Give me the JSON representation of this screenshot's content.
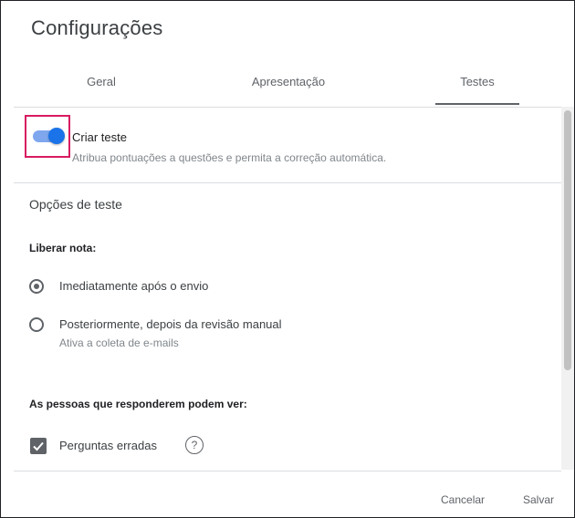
{
  "dialog": {
    "title": "Configurações"
  },
  "tabs": [
    {
      "label": "Geral",
      "active": false
    },
    {
      "label": "Apresentação",
      "active": false
    },
    {
      "label": "Testes",
      "active": true
    }
  ],
  "quiz": {
    "toggle_on": true,
    "title": "Criar teste",
    "description": "Atribua pontuações a questões e permita a correção automática."
  },
  "options": {
    "section_title": "Opções de teste",
    "release_label": "Liberar nota:",
    "release_options": [
      {
        "label": "Imediatamente após o envio",
        "checked": true,
        "sub": ""
      },
      {
        "label": "Posteriormente, depois da revisão manual",
        "checked": false,
        "sub": "Ativa a coleta de e-mails"
      }
    ],
    "can_see_label": "As pessoas que responderem podem ver:",
    "can_see_items": [
      {
        "label": "Perguntas erradas",
        "checked": true,
        "help_icon": "?"
      }
    ]
  },
  "footer": {
    "cancel_label": "Cancelar",
    "save_label": "Salvar"
  },
  "colors": {
    "accent": "#1a73e8",
    "highlight": "#d81b60",
    "text": "#3c4043"
  }
}
